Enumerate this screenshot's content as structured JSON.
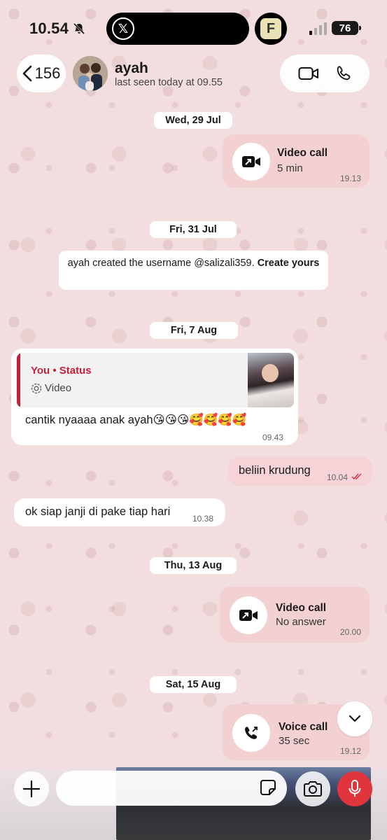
{
  "status_bar": {
    "time": "10.54",
    "battery": "76"
  },
  "header": {
    "back_count": "156",
    "contact_name": "ayah",
    "last_seen": "last seen today at 09.55"
  },
  "chat": {
    "dates": [
      "Wed, 29 Jul",
      "Fri, 31 Jul",
      "Fri, 7 Aug",
      "Thu, 13 Aug",
      "Sat, 15 Aug"
    ],
    "call_1": {
      "title": "Video call",
      "sub": "5 min",
      "time": "19.13"
    },
    "system_note": {
      "text": "ayah created the username @salizali359.",
      "link": "Create yours"
    },
    "reply_message": {
      "quote_author": "You • Status",
      "quote_type": "Video",
      "text": "cantik nyaaaa anak ayah😘😘😘🥰🥰🥰🥰",
      "time": "09.43"
    },
    "out_message": {
      "text": "beliin krudung",
      "time": "10.04"
    },
    "in_message": {
      "text": "ok siap janji di pake tiap hari",
      "time": "10.38"
    },
    "call_2": {
      "title": "Video call",
      "sub": "No answer",
      "time": "20.00"
    },
    "call_3": {
      "title": "Voice call",
      "sub": "35 sec",
      "time": "19.12"
    }
  },
  "composer": {
    "placeholder": ""
  },
  "colors": {
    "accent": "#c4203a",
    "mic": "#e0353d",
    "read_tick": "#d8344a"
  }
}
